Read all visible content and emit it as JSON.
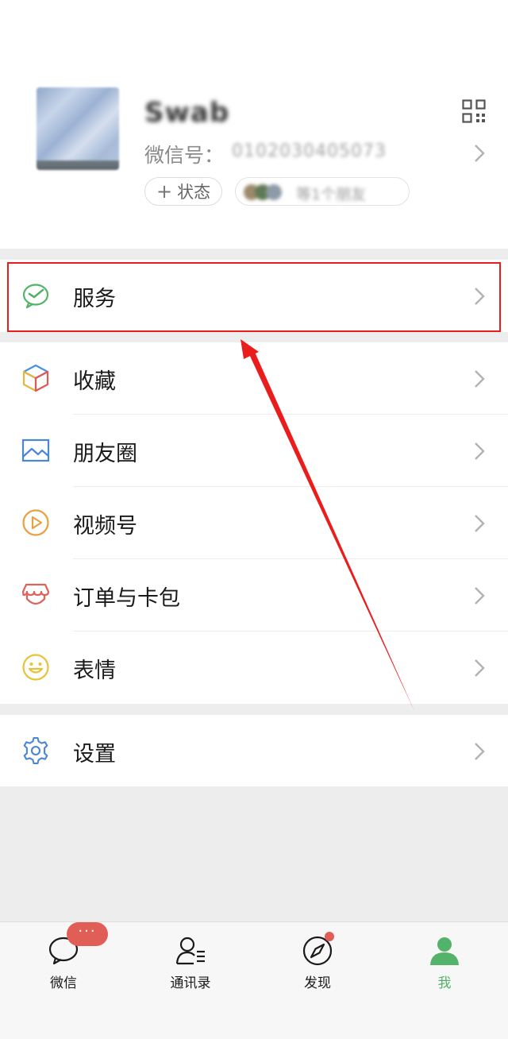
{
  "profile": {
    "nickname": "Swab",
    "wechat_id_label": "微信号：",
    "wechat_id_value": "0102030405073",
    "status_button": "状态",
    "status_plus": "+",
    "friends_status_text": "等1个朋友"
  },
  "menu": {
    "services": "服务",
    "favorites": "收藏",
    "moments": "朋友圈",
    "channels": "视频号",
    "orders_cards": "订单与卡包",
    "stickers": "表情",
    "settings": "设置"
  },
  "tabbar": {
    "chats": "微信",
    "contacts": "通讯录",
    "discover": "发现",
    "me": "我",
    "chats_badge": "···"
  },
  "colors": {
    "accent_green": "#54b36a",
    "highlight_red": "#ea1c1c",
    "badge_red": "#e05e55"
  },
  "icons": [
    "qr-code-icon",
    "wechat-pay-icon",
    "cube-icon",
    "image-icon",
    "play-circle-icon",
    "shop-awning-icon",
    "smile-icon",
    "gear-icon",
    "chat-bubble-icon",
    "contacts-icon",
    "compass-icon",
    "person-icon"
  ]
}
